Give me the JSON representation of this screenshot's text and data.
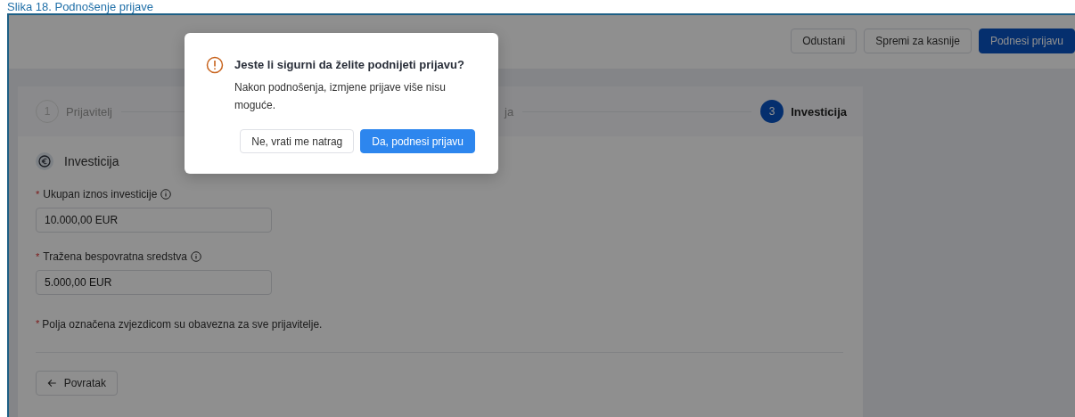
{
  "caption": "Slika 18. Podnošenje prijave",
  "header": {
    "buttons": [
      {
        "label": "Odustani",
        "kind": "outline"
      },
      {
        "label": "Spremi za kasnije",
        "kind": "outline"
      },
      {
        "label": "Podnesi prijavu",
        "kind": "primary"
      }
    ]
  },
  "stepper": [
    {
      "number": "1",
      "label": "Prijavitelj",
      "selected": false
    },
    {
      "label": "ja",
      "selected": false
    },
    {
      "number": "3",
      "label": "Investicija",
      "selected": true
    }
  ],
  "section": {
    "title": "Investicija"
  },
  "fields": [
    {
      "label": "Ukupan iznos investicije",
      "required": true,
      "value": "10.000,00 EUR"
    },
    {
      "label": "Tražena bespovratna sredstva",
      "required": true,
      "value": "5.000,00 EUR"
    }
  ],
  "note": {
    "mark": "*",
    "text": "Polja označena zvjezdicom su obavezna za sve prijavitelje."
  },
  "back_button": "Povratak",
  "dialog": {
    "title": "Jeste li sigurni da želite podnijeti prijavu?",
    "message": "Nakon podnošenja, izmjene prijave više nisu moguće.",
    "cancel": "Ne, vrati me natrag",
    "confirm": "Da, podnesi prijavu"
  }
}
